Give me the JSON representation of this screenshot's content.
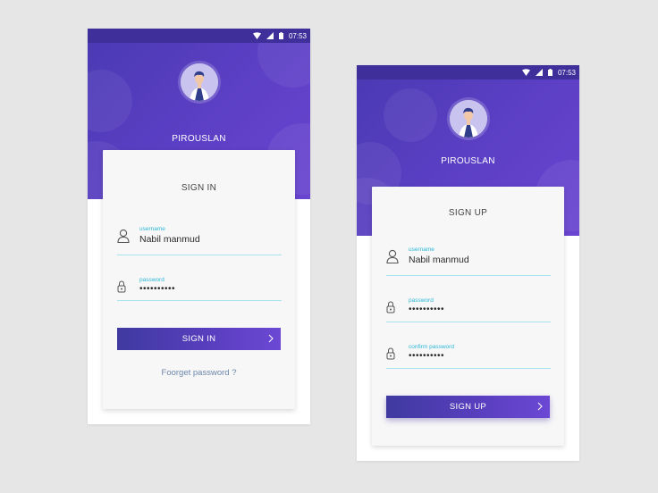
{
  "status_bar": {
    "time": "07:53"
  },
  "profile": {
    "name": "PIROUSLAN"
  },
  "signin": {
    "title": "SIGN IN",
    "username": {
      "label": "username",
      "value": "Nabil manmud"
    },
    "password": {
      "label": "password",
      "value": "••••••••••"
    },
    "button_label": "SIGN IN",
    "forgot_link": "Foorget password ?"
  },
  "signup": {
    "title": "SIGN UP",
    "username": {
      "label": "username",
      "value": "Nabil manmud"
    },
    "password": {
      "label": "password",
      "value": "••••••••••"
    },
    "confirm_password": {
      "label": "confirm password",
      "value": "••••••••••"
    },
    "button_label": "SIGN UP"
  },
  "colors": {
    "header": "#5b3fc4",
    "status_bar": "#3f2f9a",
    "accent_label": "#2bb7d6",
    "underline": "#a6e3f0",
    "link": "#6a86a8"
  },
  "icons": [
    "wifi-icon",
    "signal-icon",
    "battery-icon",
    "user-icon",
    "lock-icon",
    "chevron-right-icon"
  ]
}
